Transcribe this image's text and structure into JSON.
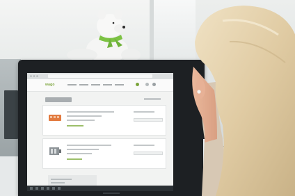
{
  "photo": {
    "subject": "person-viewing-webshop",
    "screen": {
      "logo_text": "wago",
      "accent_color": "#7aa43a"
    },
    "colors": {
      "monitor_bezel": "#1d2023",
      "bear_scarf": "#7cc243",
      "hair": "#e0cba3"
    }
  }
}
